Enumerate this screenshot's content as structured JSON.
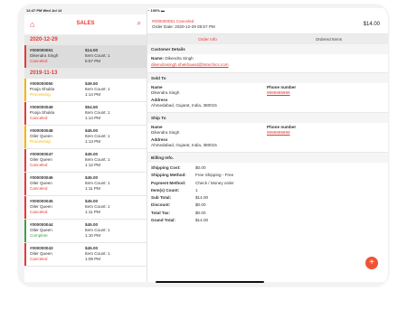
{
  "status": {
    "time": "12:47 PM  Wed Jul 14",
    "battery": "100%"
  },
  "left": {
    "title": "SALES",
    "groups": [
      {
        "date": "2020-12-29",
        "orders": [
          {
            "id": "#000000051",
            "name": "Dikendra Singh",
            "status": "Canceled",
            "price": "$14.00",
            "count": "Item Count: 1",
            "time": "5:57 PM",
            "color": "#e53935"
          }
        ]
      },
      {
        "date": "2019-11-13",
        "orders": [
          {
            "id": "#000000050",
            "name": "Pooja Shukla",
            "status": "Processing",
            "price": "$49.50",
            "count": "Item Count: 1",
            "time": "1:14 PM",
            "color": "#f2b600"
          },
          {
            "id": "#000000049",
            "name": "Pooja Shukla",
            "status": "Canceled",
            "price": "$54.50",
            "count": "Item Count: 1",
            "time": "1:14 PM",
            "color": "#e53935"
          },
          {
            "id": "#000000048",
            "name": "Oiler Queen",
            "status": "Processing",
            "price": "$45.00",
            "count": "Item Count: 1",
            "time": "1:13 PM",
            "color": "#f2b600"
          },
          {
            "id": "#000000047",
            "name": "Oiler Queen",
            "status": "Canceled",
            "price": "$45.00",
            "count": "Item Count: 1",
            "time": "1:12 PM",
            "color": "#e53935"
          },
          {
            "id": "#000000046",
            "name": "Oiler Queen",
            "status": "Canceled",
            "price": "$45.00",
            "count": "Item Count: 1",
            "time": "1:11 PM",
            "color": "#e53935"
          },
          {
            "id": "#000000045",
            "name": "Oiler Queen",
            "status": "Canceled",
            "price": "$45.00",
            "count": "Item Count: 1",
            "time": "1:11 PM",
            "color": "#e53935"
          },
          {
            "id": "#000000044",
            "name": "Oiler Queen",
            "status": "Complete",
            "price": "$45.00",
            "count": "Item Count: 1",
            "time": "1:10 PM",
            "color": "#43a047"
          },
          {
            "id": "#000000043",
            "name": "Oiler Queen",
            "status": "Canceled",
            "price": "$45.00",
            "count": "Item Count: 1",
            "time": "1:09 PM",
            "color": "#e53935"
          }
        ]
      }
    ]
  },
  "detail": {
    "order_line": "#000000051  Canceled",
    "date_line": "Order Date: 2020-12-29 05:57 PM",
    "total": "$14.00",
    "tabs": [
      "Order Info",
      "Ordered Items"
    ],
    "customer": {
      "header": "Customer Details",
      "name_label": "Name:",
      "name": "Dikendra Singh",
      "email": "dikendrasingh.shekhawat@bstechics.com"
    },
    "sold_to": {
      "header": "Sold To",
      "name_label": "Name",
      "name": "Dikendra Singh",
      "phone_label": "Phone number",
      "phone": "9999999999",
      "address_label": "Address",
      "address": "Ahmedabad, Gujarat, India, 380015"
    },
    "ship_to": {
      "header": "Ship To",
      "name_label": "Name",
      "name": "Dikendra Singh",
      "phone_label": "Phone number",
      "phone": "9999999999",
      "address_label": "Address",
      "address": "Ahmedabad, Gujarat, India, 380015"
    },
    "billing": {
      "header": "Billing Info.",
      "rows": [
        {
          "label": "Shipping Cost:",
          "value": "$0.00"
        },
        {
          "label": "Shipping Method:",
          "value": "Free Shipping - Free"
        },
        {
          "label": "Payment Method:",
          "value": "Check / Money order"
        },
        {
          "label": "Item(s) Count:",
          "value": "1"
        },
        {
          "label": "Sub Total:",
          "value": "$14.00"
        },
        {
          "label": "Discount:",
          "value": "$0.00"
        },
        {
          "label": "Total Tax:",
          "value": "$0.00"
        },
        {
          "label": "Grand Total:",
          "value": "$14.00"
        }
      ]
    },
    "fab_label": "+"
  }
}
